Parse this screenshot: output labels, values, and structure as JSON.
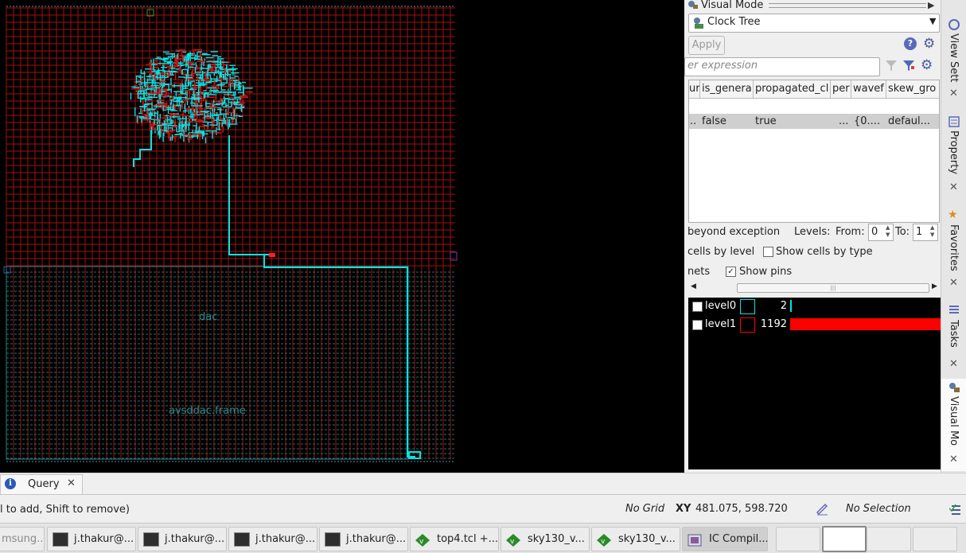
{
  "panel": {
    "header_title": "Visual Mode",
    "mode_select": "Clock Tree",
    "apply_label": "Apply",
    "filter_placeholder": "er expression",
    "columns": [
      "ur",
      "is_genera",
      "propagated_cl",
      "per",
      "wavef",
      "skew_gro"
    ],
    "row": [
      "..",
      "false",
      "true",
      "...",
      "{0....",
      "defaul..."
    ],
    "beyond_exception": "beyond exception",
    "levels_label": "Levels:",
    "from_label": "From:",
    "from_value": "0",
    "to_label": "To:",
    "to_value": "1",
    "cells_by_level": "cells by level",
    "show_cells_by_type": "Show cells by type",
    "nets_label": "nets",
    "show_pins": "Show pins",
    "levels": [
      {
        "name": "level0",
        "count": "2",
        "color": "#00e5e5",
        "fraction": 0.0
      },
      {
        "name": "level1",
        "count": "1192",
        "color": "#ff0000",
        "fraction": 1.0
      }
    ]
  },
  "side_tabs": {
    "view_settings": "View Sett",
    "property": "Property",
    "favorites": "Favorites",
    "tasks": "Tasks",
    "visual_mode": "Visual Mo"
  },
  "canvas": {
    "label_dac": "dac",
    "label_frame": "avsddac.frame",
    "colors": {
      "background": "#000000",
      "grid": "#a01010",
      "clock": "#00e5e5",
      "rows": "#1e7070"
    }
  },
  "query_tab": {
    "label": "Query"
  },
  "status": {
    "hint": "l to add, Shift to remove)",
    "grid": "No Grid",
    "xy_label": "XY",
    "xy_value": "481.075, 598.720",
    "selection": "No Selection"
  },
  "taskbar": {
    "items": [
      "msung...",
      "j.thakur@...",
      "j.thakur@...",
      "j.thakur@...",
      "j.thakur@...",
      "top4.tcl +...",
      "sky130_v...",
      "sky130_v...",
      "IC Compil..."
    ]
  }
}
